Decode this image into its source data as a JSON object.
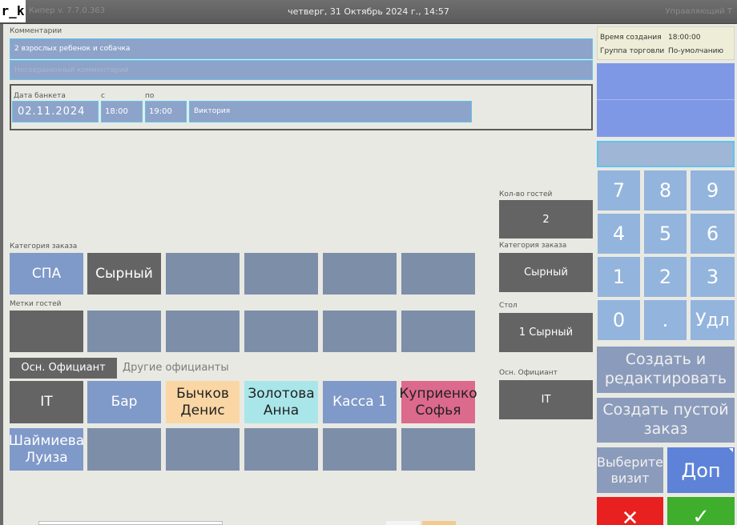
{
  "header": {
    "app_logo_text": "r_k",
    "version": "Кипер v. 7.7.0.363",
    "datetime": "четверг, 31 Октябрь 2024 г., 14:57",
    "role": "Управляющий Т"
  },
  "comments": {
    "label": "Комментарии",
    "saved": "2 взрослых ребенок и собачка",
    "unsaved_placeholder": "Несохраненный комментарий"
  },
  "banquet": {
    "date_label": "Дата банкета",
    "from_label": "с",
    "to_label": "по",
    "date": "02.11.2024",
    "from": "18:00",
    "to": "19:00",
    "name": "Виктория"
  },
  "order_category": {
    "label": "Категория заказа",
    "items": [
      "СПА",
      "Сырный",
      "",
      "",
      "",
      ""
    ]
  },
  "guest_tags": {
    "label": "Метки гостей"
  },
  "waiters": {
    "tab_main": "Осн. Официант",
    "tab_other": "Другие официанты",
    "items": [
      "IT",
      "Бар",
      "Бычков Денис",
      "Золотова Анна",
      "Касса 1",
      "Куприенко Софья",
      "Шаймиева Луиза",
      "",
      "",
      "",
      "",
      ""
    ]
  },
  "summary": {
    "guests_label": "Кол-во гостей",
    "guests_value": "2",
    "category_label": "Категория заказа",
    "category_value": "Сырный",
    "table_label": "Стол",
    "table_value": "1 Сырный",
    "waiter_label": "Осн. Официант",
    "waiter_value": "IT"
  },
  "info": {
    "created_label": "Время создания",
    "created_value": "18:00:00",
    "group_label": "Группа торговли",
    "group_value": "По-умолчанию"
  },
  "keypad": {
    "keys": [
      "7",
      "8",
      "9",
      "4",
      "5",
      "6",
      "1",
      "2",
      "3",
      "0",
      ".",
      "Удл"
    ]
  },
  "actions": {
    "create_edit": "Создать и редактировать",
    "create_empty": "Создать пустой заказ",
    "choose_visit": "Выберите визит",
    "extra": "Доп",
    "cancel": "✕",
    "ok": "✓"
  },
  "colors": {
    "tile": "#7d8ea8",
    "tile_selected": "#646464",
    "field": "#8da3c9",
    "focus_border": "#5fc3ea",
    "keypad": "#93b4dc",
    "cancel": "#e82020",
    "ok": "#3fae2c"
  }
}
